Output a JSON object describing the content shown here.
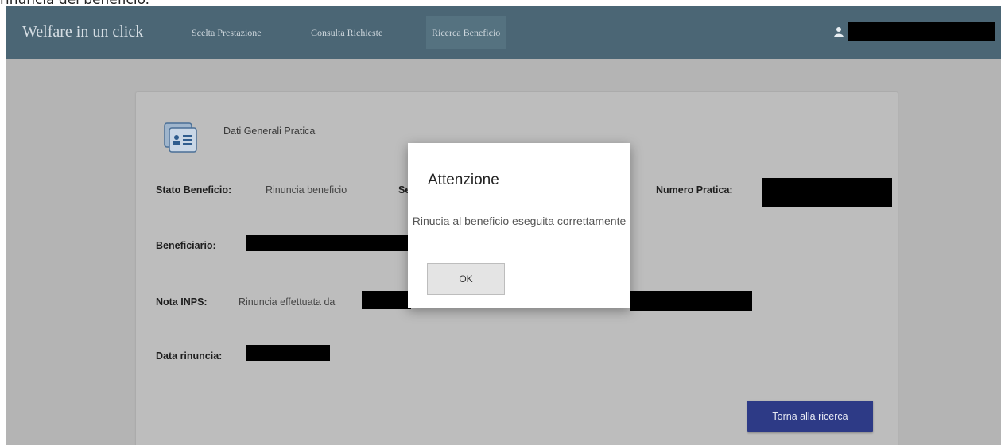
{
  "page_caption": "rinuncia del beneficio.",
  "navbar": {
    "brand": "Welfare in un click",
    "items": [
      {
        "label": "Scelta Prestazione",
        "active": false
      },
      {
        "label": "Consulta Richieste",
        "active": false
      },
      {
        "label": "Ricerca Beneficio",
        "active": true
      }
    ],
    "user_icon": "user-icon",
    "username": "[redacted]"
  },
  "card": {
    "section_title": "Dati Generali Pratica",
    "section_icon": "document-card-icon",
    "stato_label": "Stato Beneficio:",
    "stato_value": "Rinuncia beneficio",
    "hidden_label_fragment": "Se",
    "numero_label": "Numero Pratica:",
    "beneficiario_label": "Beneficiario:",
    "nota_label": "Nota INPS:",
    "nota_value": "Rinuncia effettuata da",
    "data_label": "Data rinuncia:",
    "back_button": "Torna alla ricerca"
  },
  "modal": {
    "title": "Attenzione",
    "message": "Rinucia al beneficio eseguita correttamente",
    "ok_button": "OK"
  },
  "colors": {
    "navbar": "#4b6675",
    "overlay": "#b4b4b4",
    "primary_button": "#2d3a86"
  }
}
